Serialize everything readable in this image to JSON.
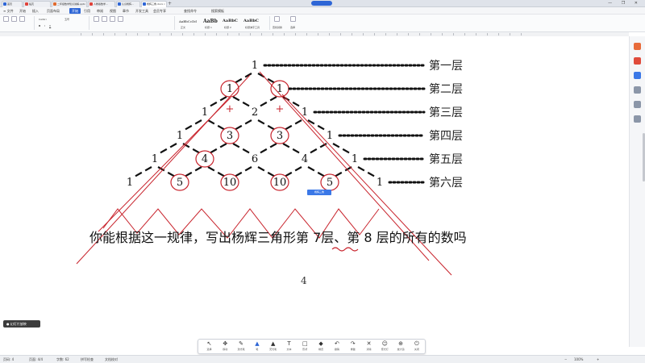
{
  "titlebar": {
    "tabs": [
      {
        "label": "首页",
        "color": "#2e66d6"
      },
      {
        "label": "稻壳",
        "color": "#e0433b"
      },
      {
        "label": "二年级数学知识讲解.pptx",
        "color": "#e06b2f"
      },
      {
        "label": "人教版数学…",
        "color": "#e0433b"
      },
      {
        "label": "认识杨辉…",
        "color": "#2e66d6"
      },
      {
        "label": "杨辉三角.docx",
        "color": "#2e66d6"
      }
    ],
    "add_symbol": "+",
    "controls": "— ❐ ✕"
  },
  "menubar": {
    "items": [
      "≡ 文件",
      "开始",
      "插入",
      "页面布局",
      "引用",
      "审阅",
      "视图",
      "章节",
      "开发工具",
      "会员专享",
      "查找命令",
      "搜索模板"
    ],
    "active": "开始"
  },
  "ribbon": {
    "font_name": "Calibri",
    "font_size": "五号",
    "style_samples": [
      "AaBbCcDd",
      "AaBb",
      "AaBbC",
      "AaBbC"
    ],
    "style_names": [
      "正文",
      "标题 1",
      "标题 2",
      "标题 3"
    ],
    "right_labels": [
      "文字工具",
      "查找替换",
      "选择"
    ]
  },
  "document": {
    "rows": [
      [
        "1"
      ],
      [
        "1",
        "1"
      ],
      [
        "1",
        "2",
        "1"
      ],
      [
        "1",
        "3",
        "3",
        "1"
      ],
      [
        "1",
        "4",
        "6",
        "4",
        "1"
      ],
      [
        "1",
        "5",
        "10",
        "10",
        "5",
        "1"
      ]
    ],
    "row_labels": [
      "第一层",
      "第二层",
      "第三层",
      "第四层",
      "第五层",
      "第六层"
    ],
    "question": {
      "before_7": "你能根据这一规律，写出杨辉三角形第 ",
      "seven": "7",
      "middle": "层、第 ",
      "eight": "8",
      "after": " 层的所有的数吗"
    },
    "page_number": "4",
    "annotations": {
      "plus": "+"
    },
    "accent_red": "#c8232c"
  },
  "ink_label": "杨辉三角",
  "corner_pill": "● 幻灯片放映",
  "pen_toolbar": {
    "tools": [
      {
        "label": "选择",
        "icon": "↖"
      },
      {
        "label": "移动",
        "icon": "✥"
      },
      {
        "label": "激光笔",
        "icon": "✎"
      },
      {
        "label": "笔",
        "icon": "▲"
      },
      {
        "label": "荧光笔",
        "icon": "▲"
      },
      {
        "label": "文本",
        "icon": "T"
      },
      {
        "label": "形状",
        "icon": "□"
      },
      {
        "label": "橡皮",
        "icon": "◆"
      },
      {
        "label": "撤销",
        "icon": "↶"
      },
      {
        "label": "重做",
        "icon": "↷"
      },
      {
        "label": "清除",
        "icon": "✕"
      },
      {
        "label": "聚光灯",
        "icon": "☺"
      },
      {
        "label": "放大镜",
        "icon": "⊕"
      },
      {
        "label": "关闭",
        "icon": "⏻"
      }
    ],
    "active": 3
  },
  "statusbar": {
    "left": [
      "页码: 4",
      "页面: 4/4",
      "字数: 62",
      "拼写检查",
      "文档校对"
    ],
    "zoom": "100%"
  }
}
